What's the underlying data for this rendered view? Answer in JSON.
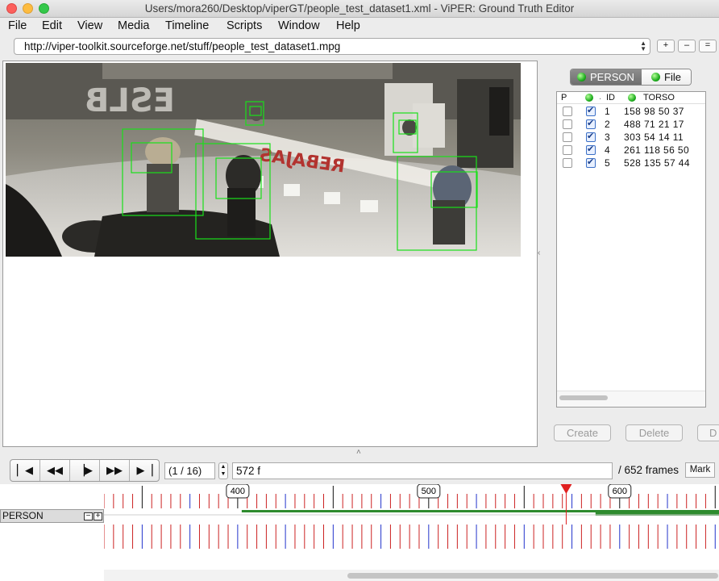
{
  "window": {
    "title": "Users/mora260/Desktop/viperGT/people_test_dataset1.xml - ViPER: Ground Truth Editor"
  },
  "menu": [
    "File",
    "Edit",
    "View",
    "Media",
    "Timeline",
    "Scripts",
    "Window",
    "Help"
  ],
  "media": {
    "url": "http://viper-toolkit.sourceforge.net/stuff/people_test_dataset1.mpg",
    "zoom_buttons": [
      "+",
      "–",
      "="
    ]
  },
  "video": {
    "storefront_text": "REBAJAS"
  },
  "descriptor_tabs": [
    {
      "label": "PERSON",
      "active": true
    },
    {
      "label": "File",
      "active": false
    }
  ],
  "table": {
    "headers": [
      "P",
      "",
      "ID",
      "TORSO"
    ],
    "rows": [
      {
        "p_checked": false,
        "visible_checked": true,
        "id": "1",
        "torso": "158 98 50 37"
      },
      {
        "p_checked": false,
        "visible_checked": true,
        "id": "2",
        "torso": "488 71 21 17"
      },
      {
        "p_checked": false,
        "visible_checked": true,
        "id": "3",
        "torso": "303 54 14 11"
      },
      {
        "p_checked": false,
        "visible_checked": true,
        "id": "4",
        "torso": "261 118 56 50"
      },
      {
        "p_checked": false,
        "visible_checked": true,
        "id": "5",
        "torso": "528 135 57 44"
      }
    ]
  },
  "actions": {
    "create": "Create",
    "delete": "Delete",
    "third": "D"
  },
  "playback": {
    "frame_position": "(1 / 16)",
    "current_frame": "572 f",
    "total_frames": "/ 652 frames",
    "mark_label": "Mark"
  },
  "timeline": {
    "track_label": "PERSON",
    "labels": [
      "400",
      "500",
      "600"
    ],
    "label_frames": [
      400,
      500,
      600
    ],
    "visible_start_frame": 330,
    "visible_end_frame": 652,
    "current_frame": 572,
    "colors": {
      "tick_red": "#cc2222",
      "tick_blue": "#2233cc",
      "track_green": "#2e8b2e",
      "marker": "#e02020"
    }
  }
}
